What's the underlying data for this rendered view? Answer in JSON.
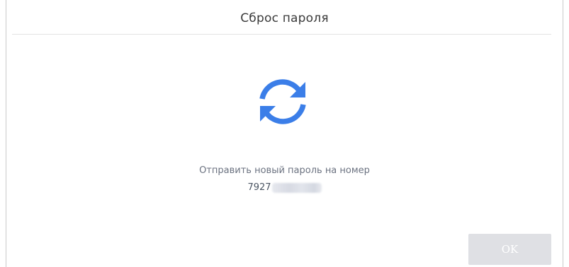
{
  "dialog": {
    "title": "Сброс пароля",
    "icon": "refresh-icon",
    "message": "Отправить новый пароль на номер",
    "phone_prefix": "7927",
    "ok_label": "OK",
    "accent_color": "#3b7ee8"
  }
}
